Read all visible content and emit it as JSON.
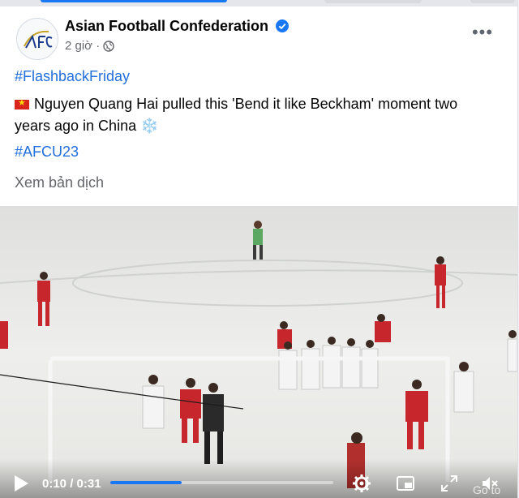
{
  "post": {
    "page_name": "Asian Football Confederation",
    "time": "2 giờ ·",
    "hashtag_1": "#FlashbackFriday",
    "text_line_1": "Nguyen Quang Hai pulled this 'Bend it like Beckham' moment two",
    "text_line_2": "years ago in China",
    "snowflake": "❄️",
    "hashtag_2": "#AFCU23",
    "see_translation": "Xem bản dịch",
    "more": "•••"
  },
  "video": {
    "current_time": "0:10",
    "separator": " / ",
    "duration": "0:31",
    "progress_fraction": 0.32,
    "watermark": "Go to"
  },
  "colors": {
    "accent": "#1877f2",
    "hashtag": "#216fdb",
    "team_red": "#c8262d",
    "team_white": "#f4f4f4"
  },
  "icons": [
    "avatar-logo",
    "verified-icon",
    "globe-icon",
    "more-icon",
    "play-icon",
    "settings-icon",
    "pip-icon",
    "fullscreen-icon",
    "volume-icon"
  ]
}
